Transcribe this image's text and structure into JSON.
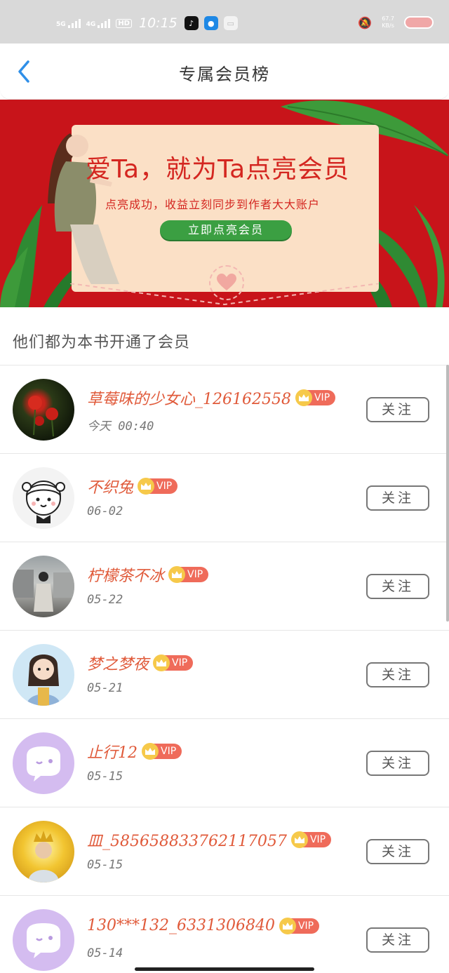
{
  "status_bar": {
    "network_1": "5G",
    "network_2": "4G",
    "hd": "HD",
    "time": "10:15",
    "speed_value": "67.7",
    "speed_unit": "KB/s"
  },
  "header": {
    "title": "专属会员榜"
  },
  "banner": {
    "headline": "爱Ta，就为Ta点亮会员",
    "subtitle": "点亮成功，收益立刻同步到作者大大账户",
    "button_label": "立即点亮会员"
  },
  "section": {
    "title": "他们都为本书开通了会员"
  },
  "vip_label": "VIP",
  "follow_label": "关注",
  "members": [
    {
      "name": "草莓味的少女心_126162558",
      "date": "今天 00:40",
      "avatar": "red-flower"
    },
    {
      "name": "不织兔",
      "date": "06-02",
      "avatar": "cartoon-girl"
    },
    {
      "name": "柠檬茶不冰",
      "date": "05-22",
      "avatar": "street-photo"
    },
    {
      "name": "梦之梦夜",
      "date": "05-21",
      "avatar": "anime-girl"
    },
    {
      "name": "止行12",
      "date": "05-15",
      "avatar": "default-chat"
    },
    {
      "name": "皿_585658833762117057",
      "date": "05-15",
      "avatar": "portrait-yellow"
    },
    {
      "name": "130***132_6331306840",
      "date": "05-14",
      "avatar": "default-chat"
    }
  ],
  "colors": {
    "accent_blue": "#2f8fe8",
    "banner_red": "#c8141a",
    "name_red": "#e05a3a",
    "vip_red": "#ef6b5a",
    "vip_gold": "#f6c94a",
    "button_green": "#3b9f42"
  }
}
